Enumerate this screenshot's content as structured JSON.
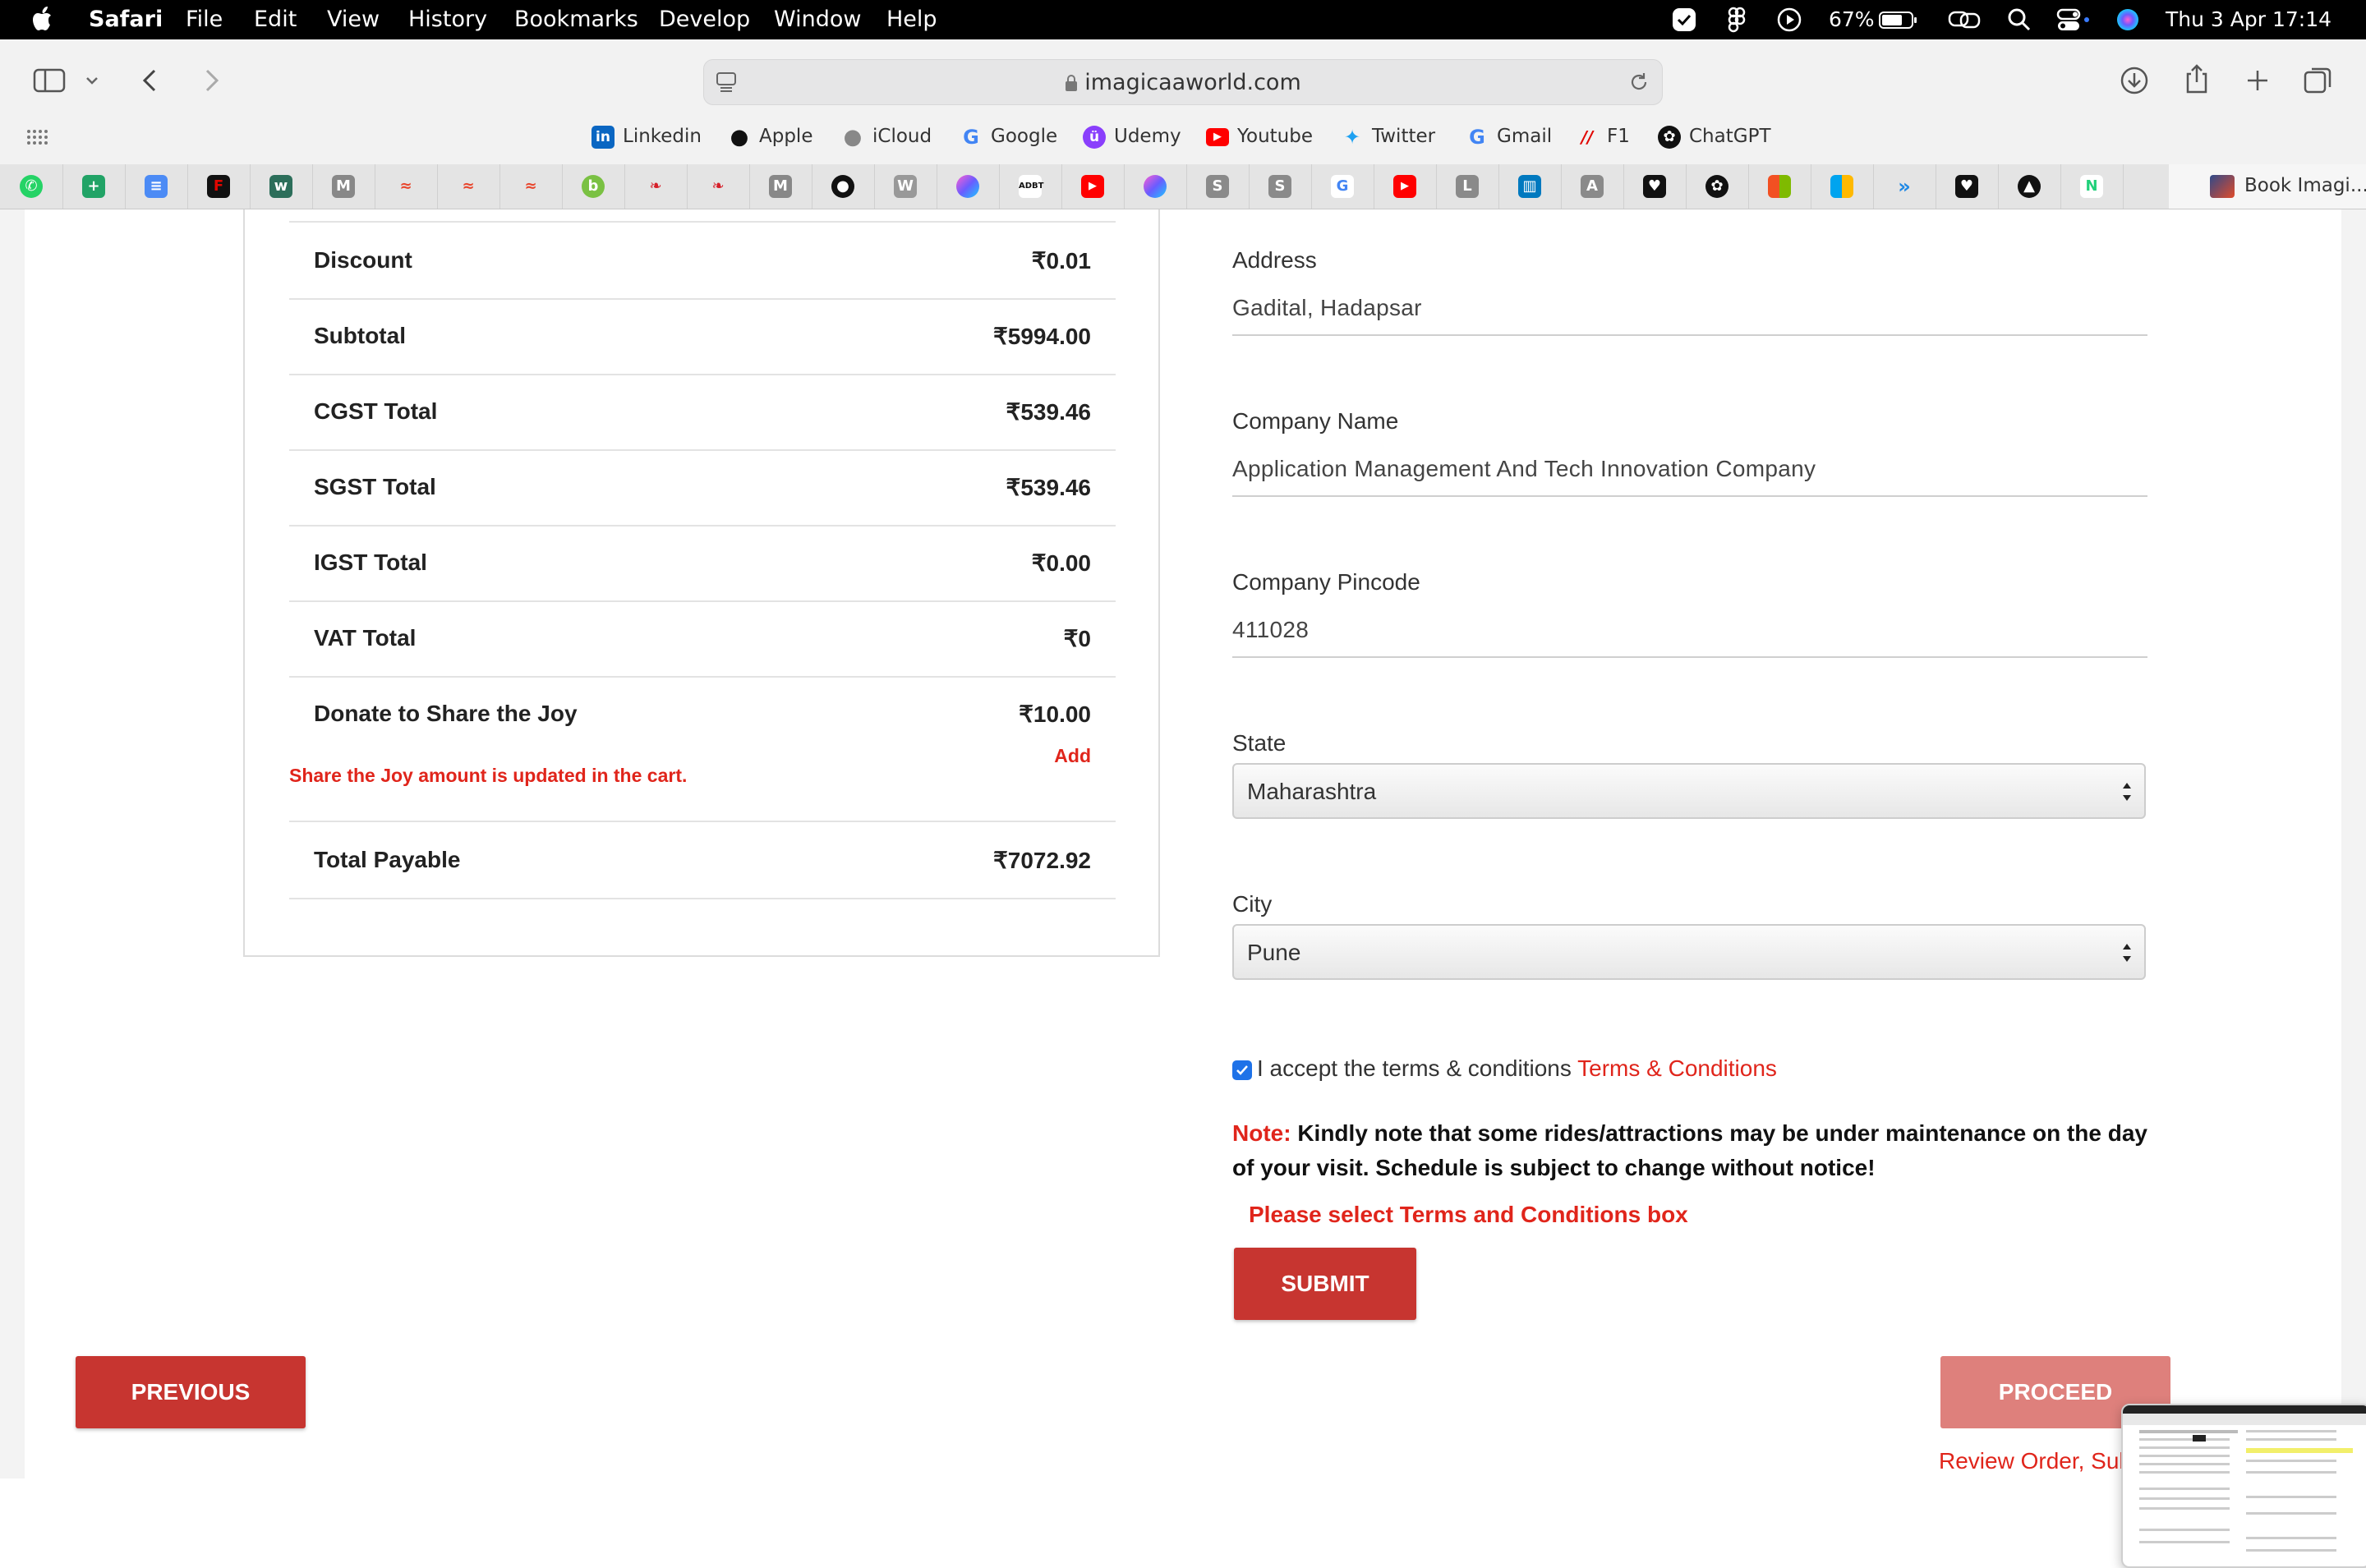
{
  "menubar": {
    "app_name": "Safari",
    "menus": [
      "File",
      "Edit",
      "View",
      "History",
      "Bookmarks",
      "Develop",
      "Window",
      "Help"
    ],
    "battery": "67%",
    "datetime": "Thu 3 Apr  17:14"
  },
  "browser": {
    "url": "imagicaaworld.com",
    "favorites": [
      "Linkedin",
      "Apple",
      "iCloud",
      "Google",
      "Udemy",
      "Youtube",
      "Twitter",
      "Gmail",
      "F1",
      "ChatGPT"
    ],
    "active_tab_title": "Book Imagi..."
  },
  "order_summary": {
    "rows": [
      {
        "label": "Discount",
        "value": "₹0.01"
      },
      {
        "label": "Subtotal",
        "value": "₹5994.00"
      },
      {
        "label": "CGST Total",
        "value": "₹539.46"
      },
      {
        "label": "SGST Total",
        "value": "₹539.46"
      },
      {
        "label": "IGST Total",
        "value": "₹0.00"
      },
      {
        "label": "VAT Total",
        "value": "₹0"
      },
      {
        "label": "Donate to Share the Joy",
        "value": "₹10.00"
      }
    ],
    "donate_add_label": "Add",
    "joy_note": "Share the Joy amount is updated in the cart.",
    "total_label": "Total Payable",
    "total_value": "₹7072.92"
  },
  "form": {
    "address": {
      "label": "Address",
      "value": "Gadital, Hadapsar"
    },
    "company_name": {
      "label": "Company Name",
      "value": "Application Management And Tech Innovation Company"
    },
    "company_pincode": {
      "label": "Company Pincode",
      "value": "411028"
    },
    "state": {
      "label": "State",
      "value": "Maharashtra"
    },
    "city": {
      "label": "City",
      "value": "Pune"
    },
    "terms": {
      "checked": true,
      "text": "I accept the terms & conditions",
      "link": "Terms & Conditions"
    },
    "note_label": "Note:",
    "note_text": "Kindly note that some rides/attractions may be under maintenance on the day of your visit. Schedule is subject to change without notice!",
    "warning": "Please select Terms and Conditions box",
    "submit_label": "SUBMIT"
  },
  "nav": {
    "previous_label": "PREVIOUS",
    "proceed_label": "PROCEED",
    "review_text": "Review Order, Submit details & Pay now"
  },
  "colors": {
    "brand_red": "#c73530",
    "alert_red": "#e0251b",
    "proceed_disabled": "#de807c",
    "checkbox_blue": "#1e72e8"
  }
}
